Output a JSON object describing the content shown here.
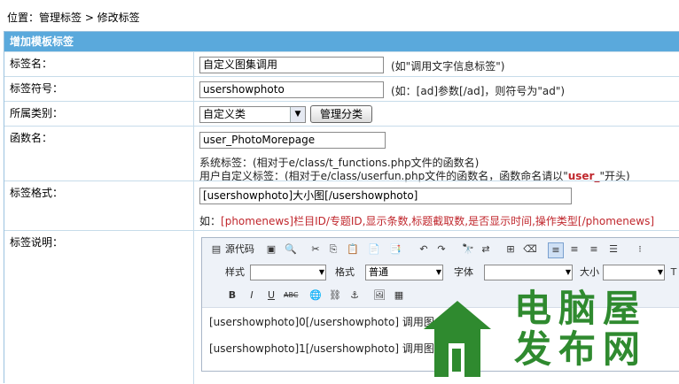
{
  "breadcrumb": "位置：管理标签 > 修改标签",
  "panel_title": "增加模板标签",
  "rows": {
    "name": {
      "label": "标签名：",
      "value": "自定义图集调用",
      "hint": "(如\"调用文字信息标签\")"
    },
    "symbol": {
      "label": "标签符号：",
      "value": "usershowphoto",
      "hint": "(如：[ad]参数[/ad]，则符号为\"ad\")"
    },
    "category": {
      "label": "所属类别：",
      "selected": "自定义类",
      "manage_button": "管理分类"
    },
    "func": {
      "label": "函数名：",
      "value": "user_PhotoMorepage",
      "note1": "系统标签：(相对于e/class/t_functions.php文件的函数名)",
      "note2_a": "用户自定义标签：(相对于e/class/userfun.php文件的函数名，函数命名请以\"",
      "note2_b": "user_",
      "note2_c": "\"开头)"
    },
    "format": {
      "label": "标签格式：",
      "value": "[usershowphoto]大小图[/usershowphoto]",
      "example_a": "如：",
      "example_b": "[phomenews]栏目ID/专题ID,显示条数,标题截取数,是否显示时间,操作类型[/phomenews]"
    },
    "desc": {
      "label": "标签说明："
    }
  },
  "editor": {
    "source_label": "源代码",
    "style_label": "样式",
    "format_label": "格式",
    "format_value": "普通",
    "font_label": "字体",
    "size_label": "大小",
    "lines": [
      "[usershowphoto]0[/usershowphoto] 调用图",
      "[usershowphoto]1[/usershowphoto] 调用图"
    ]
  },
  "watermark": {
    "chars": [
      "电",
      "脑",
      "屋",
      "发",
      "布",
      "网"
    ],
    "color": "#2f8a2f"
  }
}
